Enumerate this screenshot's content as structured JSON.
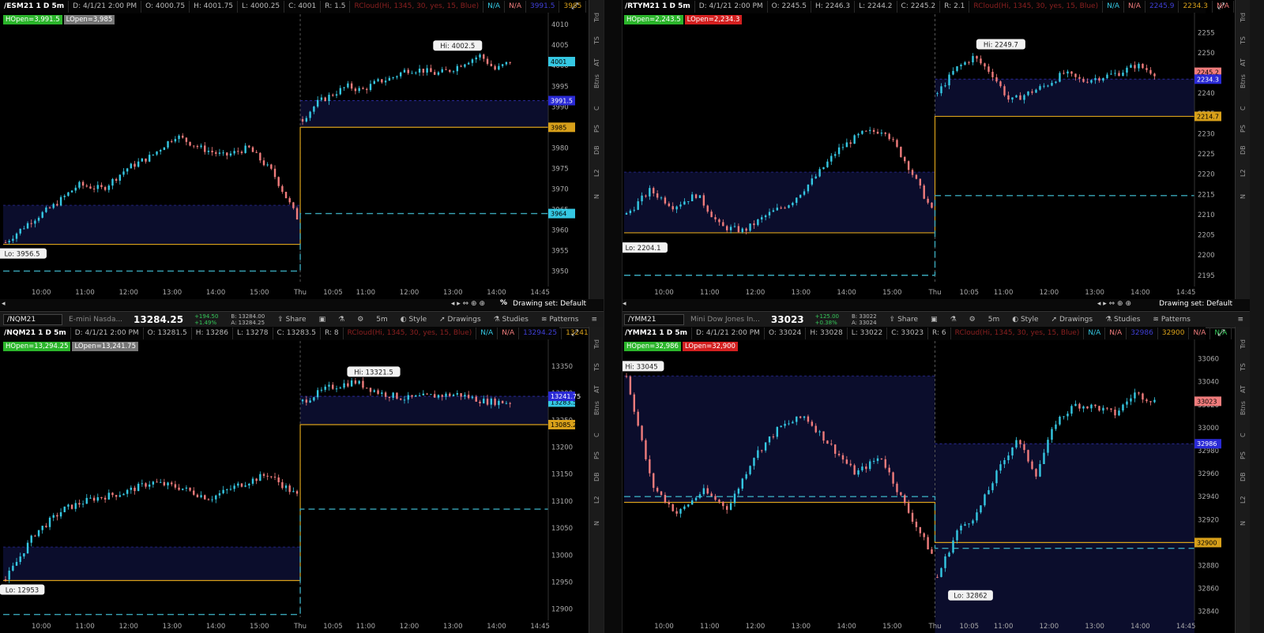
{
  "colors": {
    "up": "#35c8e3",
    "down": "#f07c7c",
    "fill": "#0b0d2c",
    "gold": "#d8a01a",
    "dash": "#39a6b9"
  },
  "layout": {
    "drawing_set": "Drawing set: Default"
  },
  "sidebar": [
    "Trd",
    "TS",
    "AT",
    "Btns",
    "C",
    "PS",
    "DB",
    "L2",
    "N"
  ],
  "toolbar": {
    "share": "Share",
    "fivem": "5m",
    "style": "Style",
    "drawings": "Drawings",
    "studies": "Studies",
    "patterns": "Patterns"
  },
  "charts": [
    {
      "id": "esm",
      "header": {
        "symbol": "/ESM21 1 D 5m",
        "date": "D: 4/1/21 2:00 PM",
        "open": "O: 4000.75",
        "high": "H: 4001.75",
        "low": "L: 4000.25",
        "close": "C: 4001",
        "range": "R: 1.5",
        "study": "RCloud(Hi, 1345, 30, yes, 15, Blue)",
        "na1": "N/A",
        "na2": "N/A",
        "v3991": "3991.5",
        "v3985": "3985",
        "na3": "N/A",
        "na4": "N/A",
        "na5": "N/A"
      },
      "hopen": "HOpen=3,991.5",
      "lopen": "LOpen=3,985",
      "hi_label": "Hi: 4002.5",
      "lo_label": "Lo: 3956.5",
      "price_tags": [
        "4001",
        "3991.5",
        "3985",
        "3964"
      ],
      "toolbar": null
    },
    {
      "id": "rty",
      "header": {
        "symbol": "/RTYM21 1 D 5m",
        "date": "D: 4/1/21 2:00 PM",
        "open": "O: 2245.5",
        "high": "H: 2246.3",
        "low": "L: 2244.2",
        "close": "C: 2245.2",
        "range": "R: 2.1",
        "study": "RCloud(Hi, 1345, 30, yes, 15, Blue)",
        "na1": "N/A",
        "na2": "N/A",
        "v3991": "2245.9",
        "v3985": "2234.3",
        "na3": "N/A",
        "na4": "N/A",
        "na5": ""
      },
      "hopen": "HOpen=2,243.5",
      "lopen": "LOpen=2,234.3",
      "hi_label": "Hi: 2249.7",
      "lo_label": "Lo: 2204.1",
      "price_tags": [
        "2245.2",
        "2234.3",
        "2214.7"
      ],
      "toolbar": null
    },
    {
      "id": "nq",
      "header": {
        "symbol": "/NQM21 1 D 5m",
        "date": "D: 4/1/21 2:00 PM",
        "open": "O: 13281.5",
        "high": "H: 13286",
        "low": "L: 13278",
        "close": "C: 13283.5",
        "range": "R: 8",
        "study": "RCloud(Hi, 1345, 30, yes, 15, Blue)",
        "na1": "N/A",
        "na2": "N/A",
        "v3991": "13294.25",
        "v3985": "13241.75",
        "na3": "N/A",
        "na4": "N/A",
        "na5": "N/A"
      },
      "hopen": "HOpen=13,294.25",
      "lopen": "LOpen=13,241.75",
      "hi_label": "Hi: 13321.5",
      "lo_label": "Lo: 12953",
      "price_tags": [
        "13283.5",
        "13241.75",
        "13085.25"
      ],
      "toolbar": {
        "symbol": "/NQM21",
        "name": "E-mini Nasda...",
        "price": "13284.25",
        "chg1": "+194.50",
        "chg2": "+1.49%",
        "bid": "B: 13284.00",
        "ask": "A: 13284.25"
      }
    },
    {
      "id": "ym",
      "header": {
        "symbol": "/YMM21 1 D 5m",
        "date": "D: 4/1/21 2:00 PM",
        "open": "O: 33024",
        "high": "H: 33028",
        "low": "L: 33022",
        "close": "C: 33023",
        "range": "R: 6",
        "study": "RCloud(Hi, 1345, 30, yes, 15, Blue)",
        "na1": "N/A",
        "na2": "N/A",
        "v3991": "32986",
        "v3985": "32900",
        "na3": "N/A",
        "na4": "N/A",
        "na5": "N/A"
      },
      "hopen": "HOpen=32,986",
      "lopen": "LOpen=32,900",
      "hi_label": "Hi: 33045",
      "lo_label": "Lo: 32862",
      "price_tags": [
        "33023",
        "32986",
        "32900"
      ],
      "toolbar": {
        "symbol": "/YMM21",
        "name": "Mini Dow Jones In...",
        "price": "33023",
        "chg1": "+125.00",
        "chg2": "+0.38%",
        "bid": "B: 33022",
        "ask": "A: 33024"
      }
    }
  ],
  "chart_data": [
    {
      "type": "candlestick",
      "symbol": "/ESM21",
      "ylim": [
        3947,
        4011
      ],
      "yticks": [
        3950,
        3955,
        3960,
        3965,
        3970,
        3975,
        3980,
        3985,
        3990,
        3995,
        4000,
        4005,
        4010
      ],
      "xticks": [
        "10:00",
        "11:00",
        "12:00",
        "13:00",
        "14:00",
        "15:00",
        "Thu",
        "10:05",
        "11:00",
        "12:00",
        "13:00",
        "14:00",
        "14:45"
      ],
      "day1_close_path": [
        3957,
        3962,
        3966,
        3971,
        3970,
        3975,
        3978,
        3983,
        3980,
        3978,
        3980,
        3974,
        3963
      ],
      "day2_path": [
        3987,
        3991,
        3993,
        3995,
        3994,
        3996,
        3997,
        3999,
        3999,
        3998,
        3999,
        4001,
        4002.5,
        3999,
        4001
      ],
      "hopen": 3991.5,
      "lopen": 3985,
      "prev_hopen": 3966,
      "prev_lopen": 3956.5,
      "dash_prev": 3950,
      "dash_day2": 3964,
      "hi": 4002.5,
      "lo": 3956.5,
      "last": 4001
    },
    {
      "type": "candlestick",
      "symbol": "/RTYM21",
      "ylim": [
        2193,
        2258
      ],
      "yticks": [
        2195,
        2200,
        2205,
        2210,
        2215,
        2220,
        2225,
        2230,
        2235,
        2240,
        2245,
        2250,
        2255
      ],
      "xticks": [
        "10:00",
        "11:00",
        "12:00",
        "13:00",
        "14:00",
        "15:00",
        "Thu",
        "10:05",
        "11:00",
        "12:00",
        "13:00",
        "14:00",
        "14:45"
      ],
      "day1_close_path": [
        2210,
        2216,
        2212,
        2215,
        2207,
        2206,
        2210,
        2213,
        2219,
        2226,
        2230,
        2231,
        2222,
        2211
      ],
      "day2_path": [
        2240,
        2246,
        2249,
        2245,
        2238,
        2240,
        2242,
        2245,
        2243,
        2244,
        2245,
        2247,
        2245
      ],
      "hopen": 2243.5,
      "lopen": 2234.3,
      "prev_hopen": 2220.5,
      "prev_lopen": 2205.5,
      "dash_prev": 2195,
      "dash_day2": 2214.7,
      "hi": 2249.7,
      "lo": 2204.1,
      "last": 2245.2
    },
    {
      "type": "candlestick",
      "symbol": "/NQM21",
      "ylim": [
        12885,
        13385
      ],
      "yticks": [
        12900,
        12950,
        13000,
        13050,
        13100,
        13150,
        13200,
        13250,
        13300,
        13350
      ],
      "xticks": [
        "10:00",
        "11:00",
        "12:00",
        "13:00",
        "14:00",
        "15:00",
        "Thu",
        "10:05",
        "11:00",
        "12:00",
        "13:00",
        "14:00",
        "14:45"
      ],
      "day1_close_path": [
        12955,
        13040,
        13085,
        13105,
        13115,
        13135,
        13125,
        13105,
        13130,
        13150,
        13110
      ],
      "day2_path": [
        13285,
        13310,
        13321.5,
        13300,
        13290,
        13295,
        13298,
        13285,
        13283
      ],
      "hopen": 13294.25,
      "lopen": 13241.75,
      "prev_hopen": 13015,
      "prev_lopen": 12953,
      "dash_prev": 12890,
      "dash_day2": 13085.25,
      "hi": 13321.5,
      "lo": 12953,
      "last": 13283.5
    },
    {
      "type": "candlestick",
      "symbol": "/YMM21",
      "ylim": [
        32835,
        33070
      ],
      "yticks": [
        32840,
        32860,
        32880,
        32900,
        32920,
        32940,
        32960,
        32980,
        33000,
        33020,
        33040,
        33060
      ],
      "xticks": [
        "10:00",
        "11:00",
        "12:00",
        "13:00",
        "14:00",
        "15:00",
        "Thu",
        "10:05",
        "11:00",
        "12:00",
        "13:00",
        "14:00",
        "14:45"
      ],
      "day1_close_path": [
        33045,
        32950,
        32925,
        32945,
        32930,
        32975,
        33000,
        33010,
        32985,
        32960,
        32975,
        32930,
        32890
      ],
      "day2_path": [
        32870,
        32910,
        32925,
        32960,
        32990,
        32960,
        33005,
        33020,
        33018,
        33012,
        33030,
        33023
      ],
      "hopen": 32986,
      "lopen": 32900,
      "prev_hopen": 33045,
      "prev_lopen": 32935,
      "dash_prev": 32940,
      "dash_day2": 32895,
      "hi": 33045,
      "lo": 32862,
      "last": 33023
    }
  ]
}
